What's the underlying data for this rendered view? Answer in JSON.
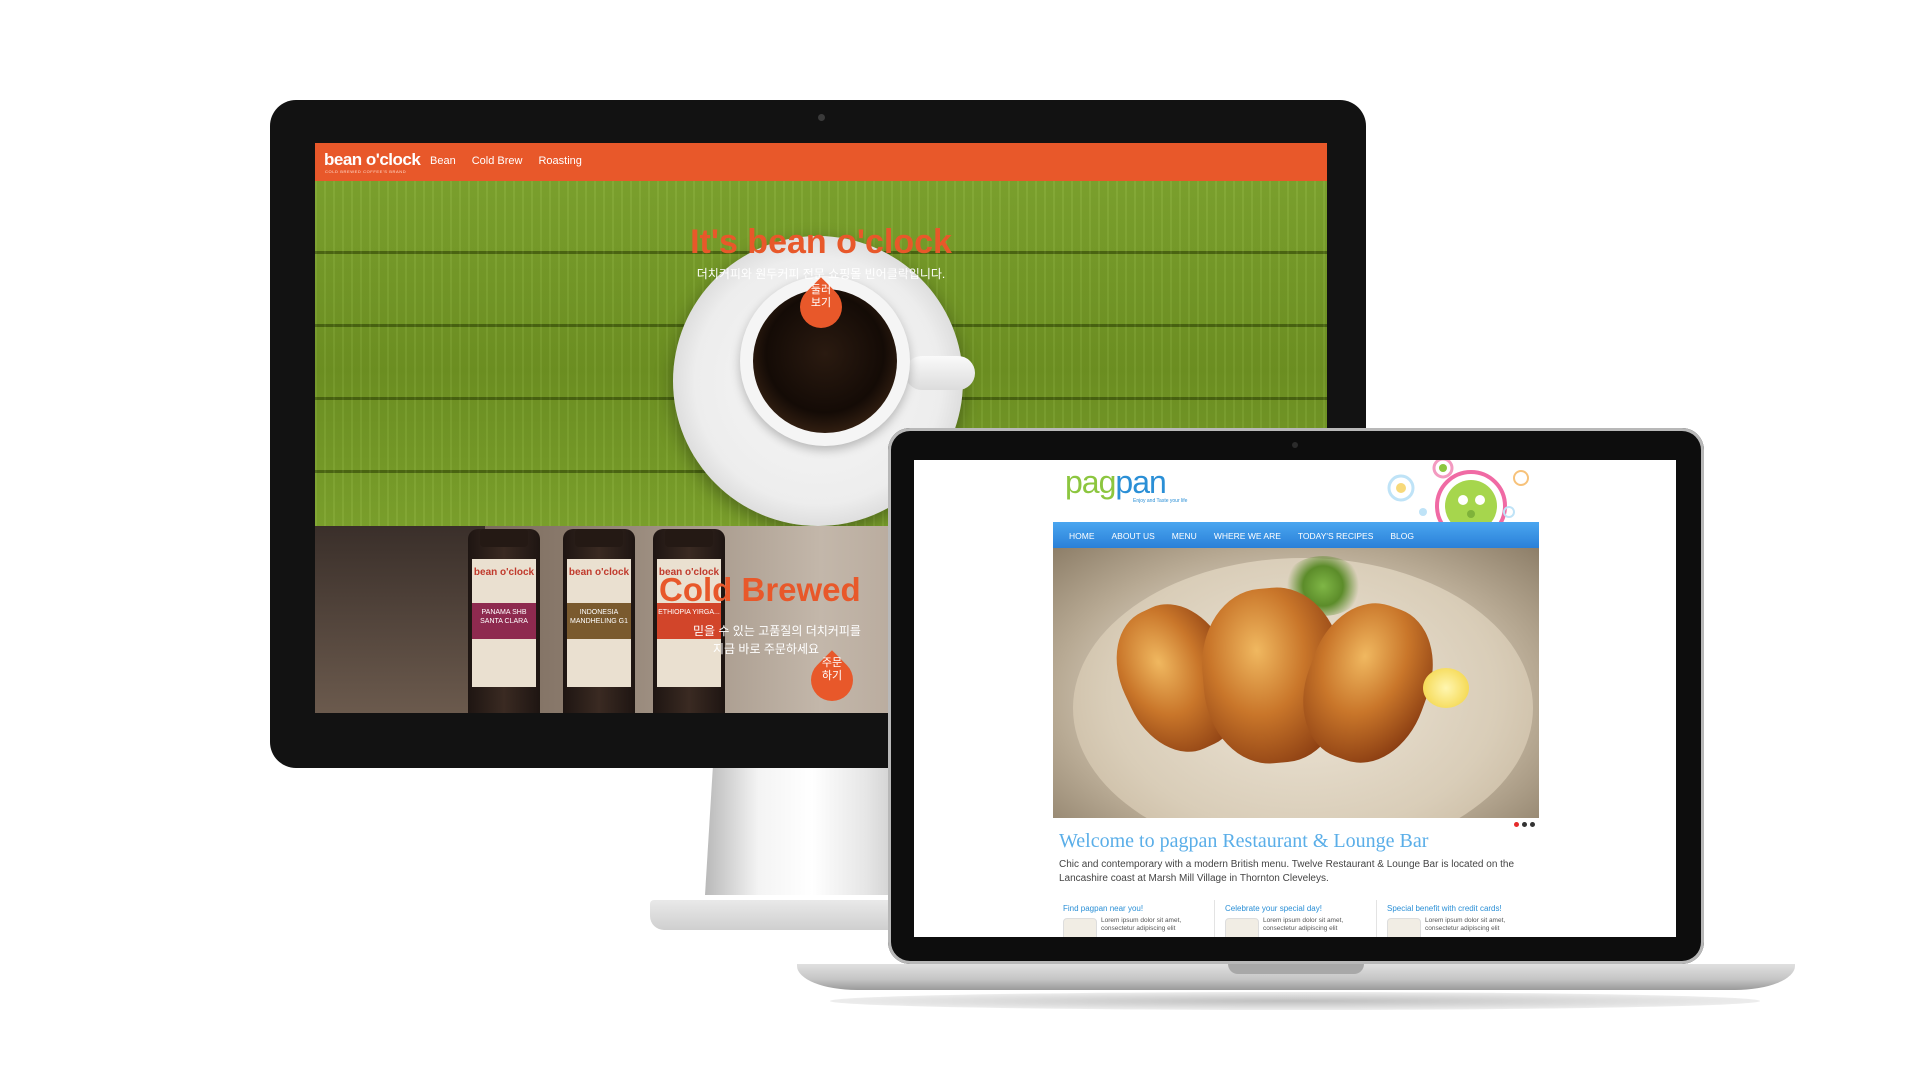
{
  "imac_site": {
    "nav": {
      "logo": "bean o'clock",
      "logo_sub": "COLD BREWED COFFEE'S BRAND",
      "items": [
        "Bean",
        "Cold Brew",
        "Roasting"
      ]
    },
    "hero": {
      "title": "It's bean o'clock",
      "subtitle": "더치커피와 원두커피 전문 쇼핑몰 빈어클락입니다.",
      "cta_line1": "둘러",
      "cta_line2": "보기"
    },
    "cold_brew": {
      "title": "Cold Brewed",
      "line1": "믿을 수 있는 고품질의 더치커피를",
      "line2": "지금 바로 주문하세요",
      "cta_line1": "주문",
      "cta_line2": "하기",
      "bottles": [
        {
          "brand": "bean o'clock",
          "name": "PANAMA SHB SANTA CLARA",
          "color": "#8e2a4f"
        },
        {
          "brand": "bean o'clock",
          "name": "INDONESIA MANDHELING G1",
          "color": "#7a5a2e"
        },
        {
          "brand": "bean o'clock",
          "name": "ETHIOPIA YIRGA...",
          "color": "#d2452a"
        }
      ]
    },
    "accent_color": "#e8582a"
  },
  "macbook_site": {
    "logo_green": "pag",
    "logo_blue": "pan",
    "tagline": "Enjoy and Taste your life",
    "nav": [
      "HOME",
      "ABOUT US",
      "MENU",
      "WHERE WE ARE",
      "TODAY'S RECIPES",
      "BLOG"
    ],
    "welcome_title": "Welcome to pagpan Restaurant & Lounge Bar",
    "welcome_text": "Chic and contemporary with a modern British menu. Twelve Restaurant & Lounge Bar is located on the Lancashire coast at Marsh Mill Village in Thornton Cleveleys.",
    "columns": [
      {
        "title": "Find pagpan near you!",
        "text": "Lorem ipsum dolor sit amet, consectetur adipiscing elit"
      },
      {
        "title": "Celebrate your special day!",
        "text": "Lorem ipsum dolor sit amet, consectetur adipiscing elit"
      },
      {
        "title": "Special benefit with credit cards!",
        "text": "Lorem ipsum dolor sit amet, consectetur adipiscing elit"
      }
    ],
    "slider_dots": [
      "#e52b2b",
      "#333333",
      "#333333"
    ],
    "nav_color": "#2a80d8"
  }
}
